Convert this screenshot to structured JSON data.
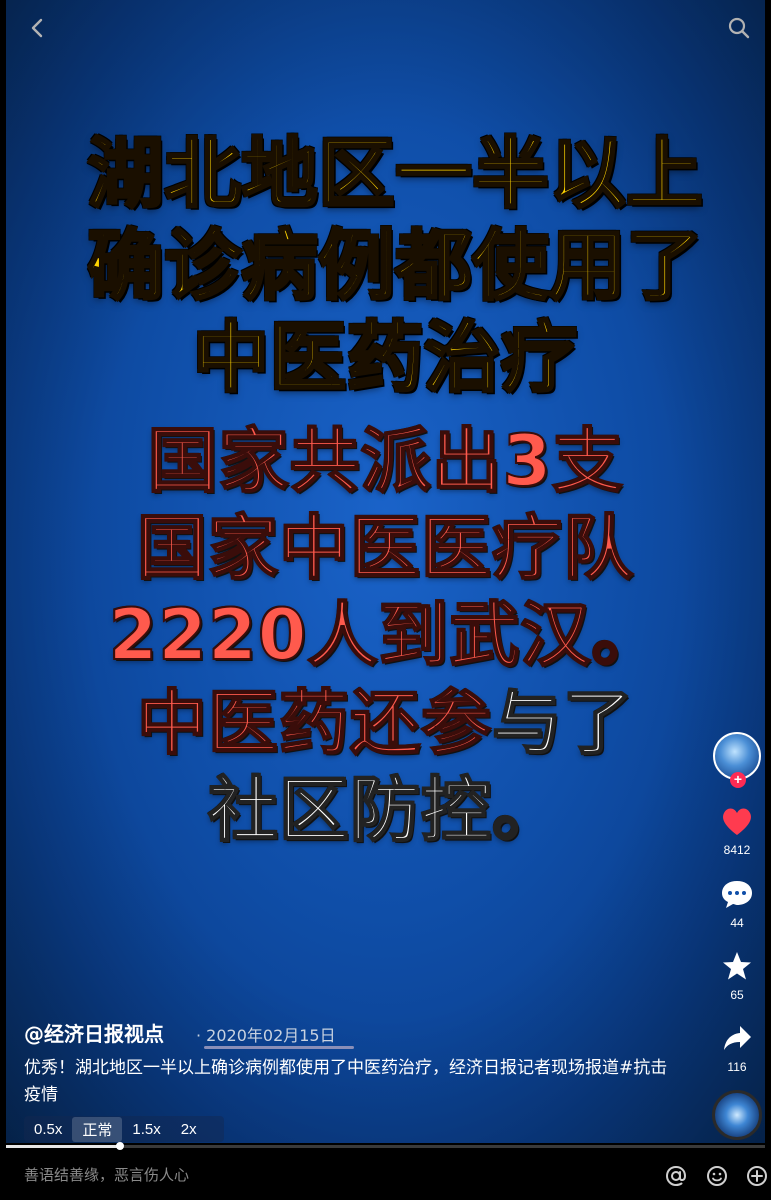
{
  "video": {
    "title_lines": [
      "湖北地区一半以上",
      "确诊病例都使用了",
      "中医药治疗"
    ],
    "body_lines": [
      "国家共派出3支",
      "国家中医医疗队",
      "2220人到武汉。"
    ],
    "line7_red": "中医药还参",
    "line7_white": "与了",
    "line8": "社区防控。"
  },
  "sidebar": {
    "likes": "8412",
    "comments": "44",
    "favorites": "65",
    "shares": "116"
  },
  "post": {
    "author": "@经济日报视点",
    "date": "· 2020年02月15日",
    "description": "优秀！湖北地区一半以上确诊病例都使用了中医药治疗，经济日报记者现场报道#抗击疫情"
  },
  "speeds": [
    "0.5x",
    "正常",
    "1.5x",
    "2x"
  ],
  "active_speed": "正常",
  "playback_progress": 0.15,
  "comment_placeholder": "善语结善缘，恶言伤人心",
  "colors": {
    "title": "#ffd400",
    "body": "#ff5a4d",
    "like": "#ff3b4f",
    "background": "#0f4ea8"
  }
}
